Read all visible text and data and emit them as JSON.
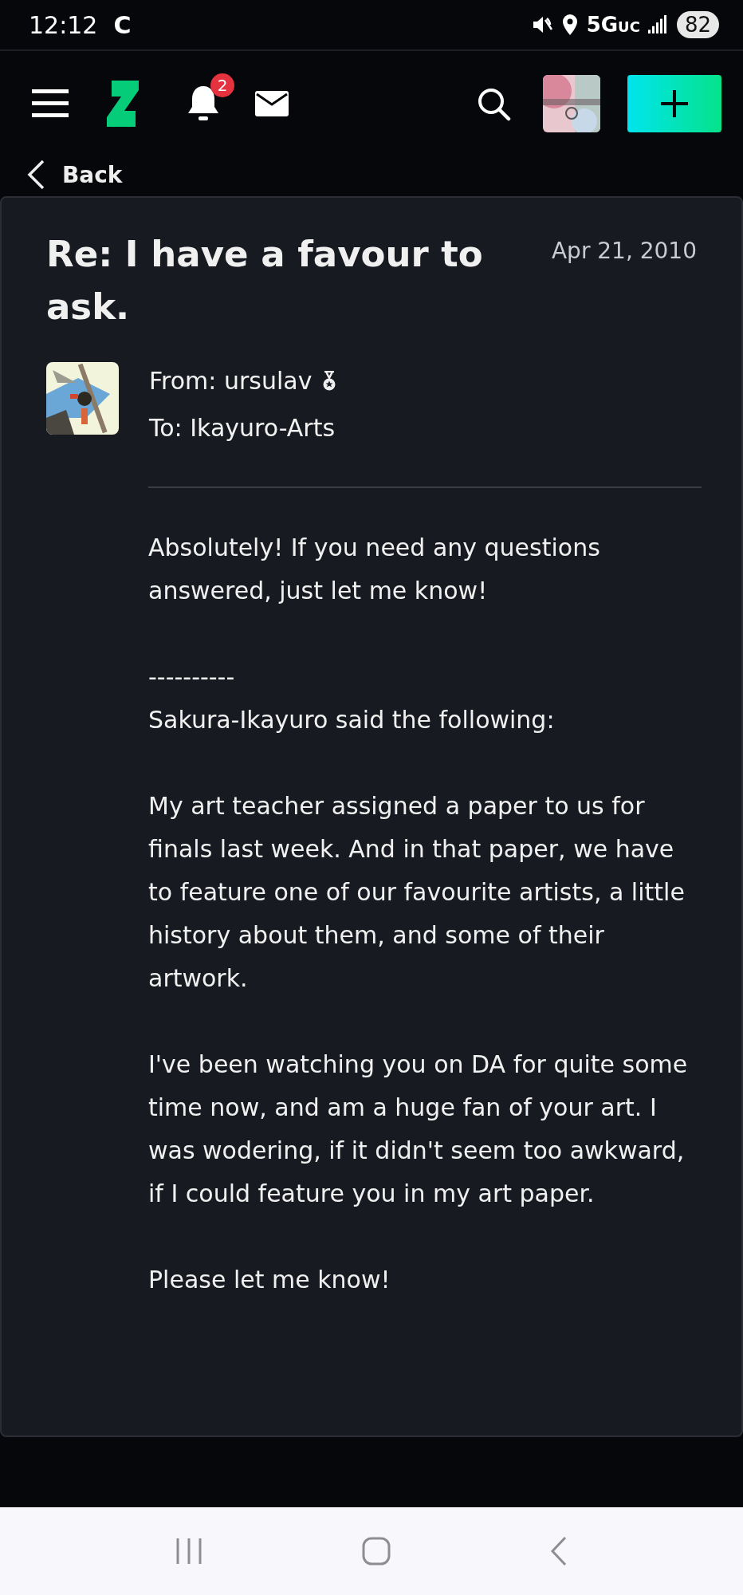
{
  "status_bar": {
    "time": "12:12",
    "carrier_glyph": "C",
    "network": "5G",
    "network_sub": "UC",
    "battery": "82"
  },
  "top_nav": {
    "notification_count": "2"
  },
  "back": {
    "label": "Back"
  },
  "message": {
    "title": "Re: I have a favour to ask.",
    "date": "Apr 21, 2010",
    "from": "From: ursulav",
    "to": "To: Ikayuro-Arts",
    "paragraphs": [
      [
        "Absolutely! If you need any questions answered, just let me know!"
      ],
      [
        "----------",
        "Sakura-Ikayuro said the following:"
      ],
      [
        "My art teacher assigned a paper to us for finals last week. And in that paper, we have to feature one of our favourite artists, a little history about them, and some of their artwork."
      ],
      [
        "I've been watching you on DA for quite some time now, and am a huge fan of your art. I was wodering, if it didn't seem too awkward, if I could feature you in my art paper."
      ],
      [
        "Please let me know!"
      ]
    ]
  }
}
